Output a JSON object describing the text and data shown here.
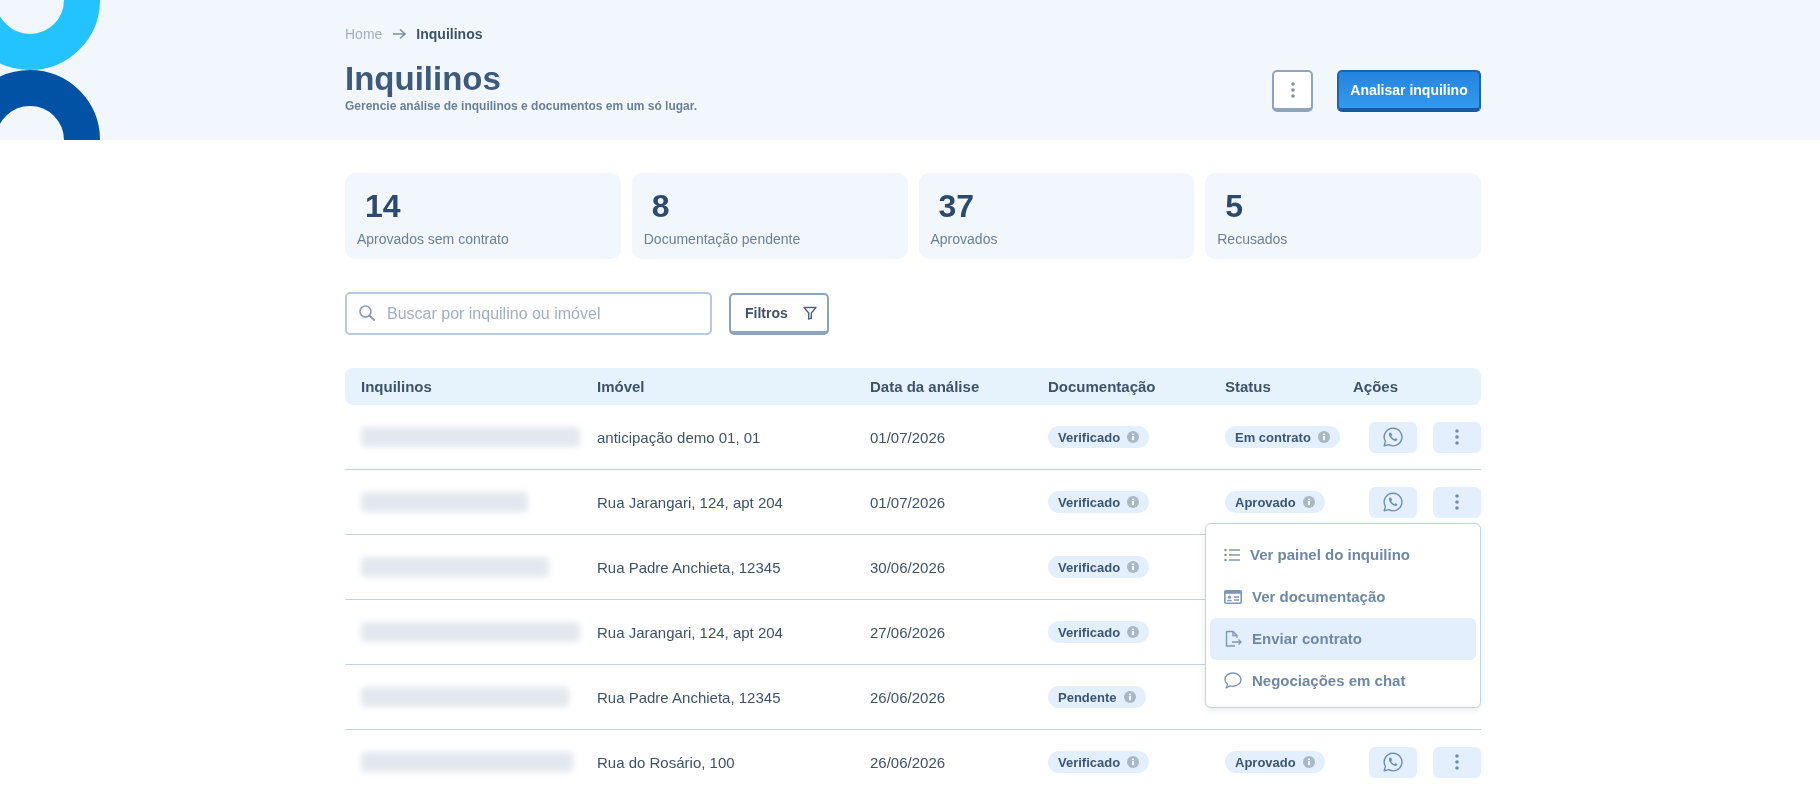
{
  "breadcrumb": [
    {
      "label": "Home",
      "current": false
    },
    {
      "label": "Inquilinos",
      "current": true
    }
  ],
  "header": {
    "title": "Inquilinos",
    "subtitle": "Gerencie análise de inquilinos e documentos em um só lugar.",
    "primary_button": "Analisar inquilino"
  },
  "stats": [
    {
      "value": "14",
      "label": "Aprovados sem contrato"
    },
    {
      "value": "8",
      "label": "Documentação pendente"
    },
    {
      "value": "37",
      "label": "Aprovados"
    },
    {
      "value": "5",
      "label": "Recusados"
    }
  ],
  "search": {
    "placeholder": "Buscar por inquilino ou imóvel"
  },
  "filter_button": "Filtros",
  "table": {
    "columns": [
      "Inquilinos",
      "Imóvel",
      "Data da análise",
      "Documentação",
      "Status",
      "Ações"
    ],
    "rows": [
      {
        "property": "anticipação demo 01, 01",
        "date": "01/07/2026",
        "documentation": "Verificado",
        "status": "Em contrato"
      },
      {
        "property": "Rua Jarangari, 124, apt 204",
        "date": "01/07/2026",
        "documentation": "Verificado",
        "status": "Aprovado",
        "menu": {
          "items": [
            {
              "label": "Ver painel do inquilino",
              "selected": false
            },
            {
              "label": "Ver documentação",
              "selected": false
            },
            {
              "label": "Enviar contrato",
              "selected": true
            },
            {
              "label": "Negociações em chat",
              "selected": false
            }
          ]
        }
      },
      {
        "property": "Rua Padre Anchieta, 12345",
        "date": "30/06/2026",
        "documentation": "Verificado"
      },
      {
        "property": "Rua Jarangari, 124, apt 204",
        "date": "27/06/2026",
        "documentation": "Verificado"
      },
      {
        "property": "Rua Padre Anchieta, 12345",
        "date": "26/06/2026",
        "documentation": "Pendente"
      },
      {
        "property": "Rua do Rosário, 100",
        "date": "26/06/2026",
        "documentation": "Verificado",
        "status": "Aprovado"
      }
    ]
  }
}
